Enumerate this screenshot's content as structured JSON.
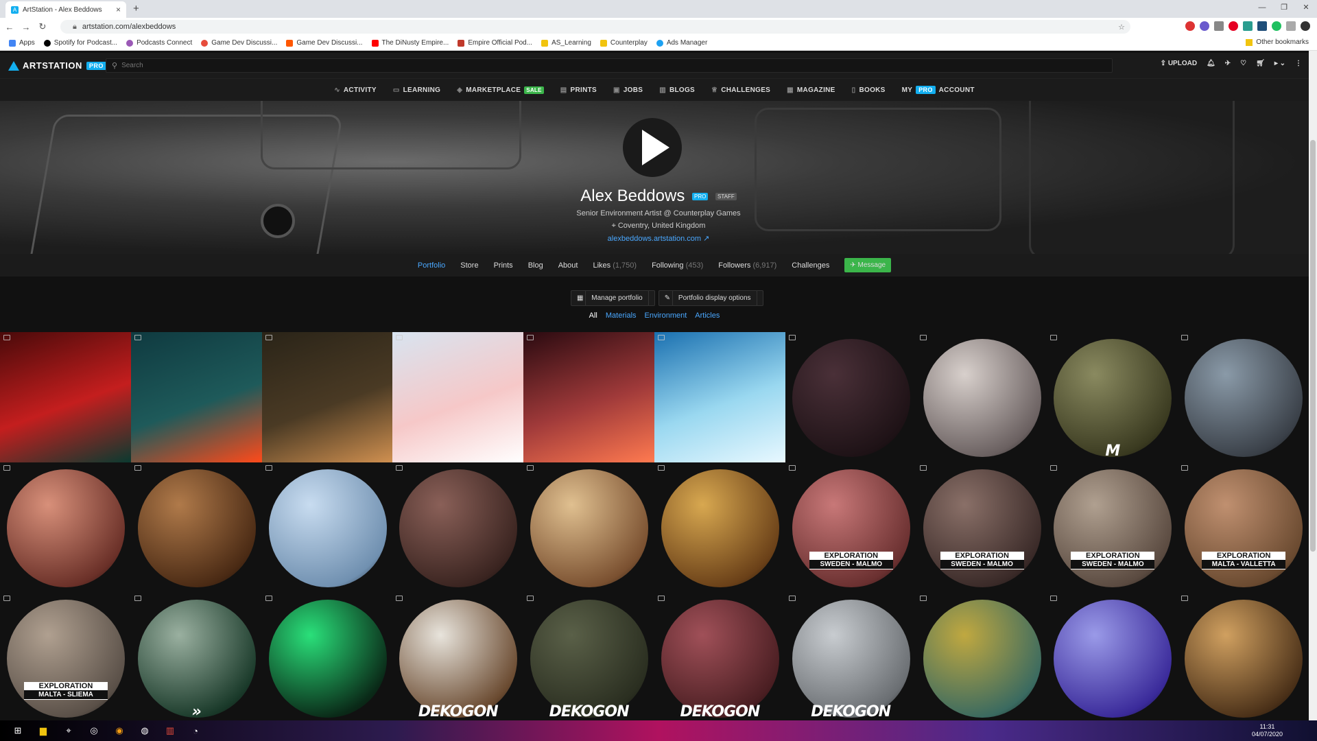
{
  "browser": {
    "tab_title": "ArtStation - Alex Beddows",
    "url": "artstation.com/alexbeddows",
    "bookmarks": [
      "Apps",
      "Spotify for Podcast...",
      "Podcasts Connect",
      "Game Dev Discussi...",
      "Game Dev Discussi...",
      "The DiNusty Empire...",
      "Empire Official Pod...",
      "AS_Learning",
      "Counterplay",
      "Ads Manager"
    ],
    "other_bookmarks": "Other bookmarks"
  },
  "header": {
    "logo": "ARTSTATION",
    "pro": "PRO",
    "search_placeholder": "Search",
    "upload": "UPLOAD"
  },
  "menu": [
    {
      "label": "ACTIVITY"
    },
    {
      "label": "LEARNING"
    },
    {
      "label": "MARKETPLACE",
      "badge": "SALE"
    },
    {
      "label": "PRINTS"
    },
    {
      "label": "JOBS"
    },
    {
      "label": "BLOGS"
    },
    {
      "label": "CHALLENGES"
    },
    {
      "label": "MAGAZINE"
    },
    {
      "label": "BOOKS"
    },
    {
      "label": "MY",
      "badge": "PRO",
      "after": "ACCOUNT"
    }
  ],
  "profile": {
    "name": "Alex Beddows",
    "pro_badge": "PRO",
    "staff_badge": "STAFF",
    "headline": "Senior Environment Artist @ Counterplay Games",
    "location": "Coventry, United Kingdom",
    "website": "alexbeddows.artstation.com"
  },
  "tabs": {
    "portfolio": "Portfolio",
    "store": "Store",
    "prints": "Prints",
    "blog": "Blog",
    "about": "About",
    "likes": "Likes",
    "likes_count": "(1,750)",
    "following": "Following",
    "following_count": "(453)",
    "followers": "Followers",
    "followers_count": "(6,917)",
    "challenges": "Challenges",
    "message": "Message"
  },
  "tools": {
    "manage": "Manage portfolio",
    "display": "Portfolio display options"
  },
  "filters": [
    "All",
    "Materials",
    "Environment",
    "Articles"
  ],
  "tiles": [
    {
      "kind": "scene",
      "colors": [
        "#4a0a0a",
        "#c41e1e",
        "#0a3a30"
      ]
    },
    {
      "kind": "scene",
      "colors": [
        "#0f3a40",
        "#1e5a5a",
        "#ff4a1a"
      ]
    },
    {
      "kind": "scene",
      "colors": [
        "#2a2418",
        "#4a3a24",
        "#d09050"
      ]
    },
    {
      "kind": "scene",
      "colors": [
        "#d8e4f0",
        "#f6c8c8",
        "#ffffff"
      ]
    },
    {
      "kind": "scene",
      "colors": [
        "#2a0a10",
        "#a03a3a",
        "#ff7a50"
      ]
    },
    {
      "kind": "scene",
      "colors": [
        "#1a70b0",
        "#9ad8f0",
        "#e8f8ff"
      ]
    },
    {
      "kind": "ball",
      "colors": [
        "#4a3038",
        "#1e1216"
      ]
    },
    {
      "kind": "ball",
      "colors": [
        "#d8d0cc",
        "#6a6060"
      ]
    },
    {
      "kind": "ball",
      "colors": [
        "#8a8a60",
        "#3a3a20"
      ],
      "brand": "M"
    },
    {
      "kind": "ball",
      "colors": [
        "#8a9aa8",
        "#3a4048"
      ]
    },
    {
      "kind": "ball",
      "colors": [
        "#d8907a",
        "#6a3028"
      ]
    },
    {
      "kind": "ball",
      "colors": [
        "#b07a4a",
        "#4a2a14"
      ]
    },
    {
      "kind": "ball",
      "colors": [
        "#c8dcf0",
        "#7090b0"
      ]
    },
    {
      "kind": "ball",
      "colors": [
        "#8a6058",
        "#3a2420"
      ]
    },
    {
      "kind": "ball",
      "colors": [
        "#e0c090",
        "#7a5030"
      ]
    },
    {
      "kind": "ball",
      "colors": [
        "#d8a850",
        "#6a4018"
      ]
    },
    {
      "kind": "ball",
      "colors": [
        "#c87878",
        "#6a3030"
      ],
      "tag": "EXPLORATION",
      "tag2": "SWEDEN - MALMO"
    },
    {
      "kind": "ball",
      "colors": [
        "#8a7068",
        "#3a2a28"
      ],
      "tag": "EXPLORATION",
      "tag2": "SWEDEN - MALMO"
    },
    {
      "kind": "ball",
      "colors": [
        "#b0a090",
        "#5a4a40"
      ],
      "tag": "EXPLORATION",
      "tag2": "SWEDEN - MALMO"
    },
    {
      "kind": "ball",
      "colors": [
        "#c09070",
        "#6a4a30"
      ],
      "tag": "EXPLORATION",
      "tag2": "MALTA - VALLETTA"
    },
    {
      "kind": "ball",
      "colors": [
        "#b0a090",
        "#5a5048"
      ],
      "tag": "EXPLORATION",
      "tag2": "MALTA - SLIEMA"
    },
    {
      "kind": "ball",
      "colors": [
        "#9ab0a0",
        "#1a3a2a"
      ],
      "brand": "»"
    },
    {
      "kind": "ball",
      "colors": [
        "#2ae07a",
        "#0a2a18"
      ]
    },
    {
      "kind": "ball",
      "colors": [
        "#e8e4dc",
        "#6a4a30"
      ],
      "brand": "DEKOGON"
    },
    {
      "kind": "ball",
      "colors": [
        "#5a6048",
        "#2a2e20"
      ],
      "brand": "DEKOGON"
    },
    {
      "kind": "ball",
      "colors": [
        "#a05058",
        "#4a1e22"
      ],
      "brand": "DEKOGON"
    },
    {
      "kind": "ball",
      "colors": [
        "#c8ccd0",
        "#6a6e72"
      ],
      "brand": "DEKOGON"
    },
    {
      "kind": "ball",
      "colors": [
        "#c0a840",
        "#3a6a60"
      ]
    },
    {
      "kind": "ball",
      "colors": [
        "#9a9ae8",
        "#3a2a9a"
      ]
    },
    {
      "kind": "ball",
      "colors": [
        "#d0a060",
        "#4a3018"
      ]
    }
  ],
  "taskbar": {
    "time": "11:31",
    "date": "04/07/2020"
  }
}
